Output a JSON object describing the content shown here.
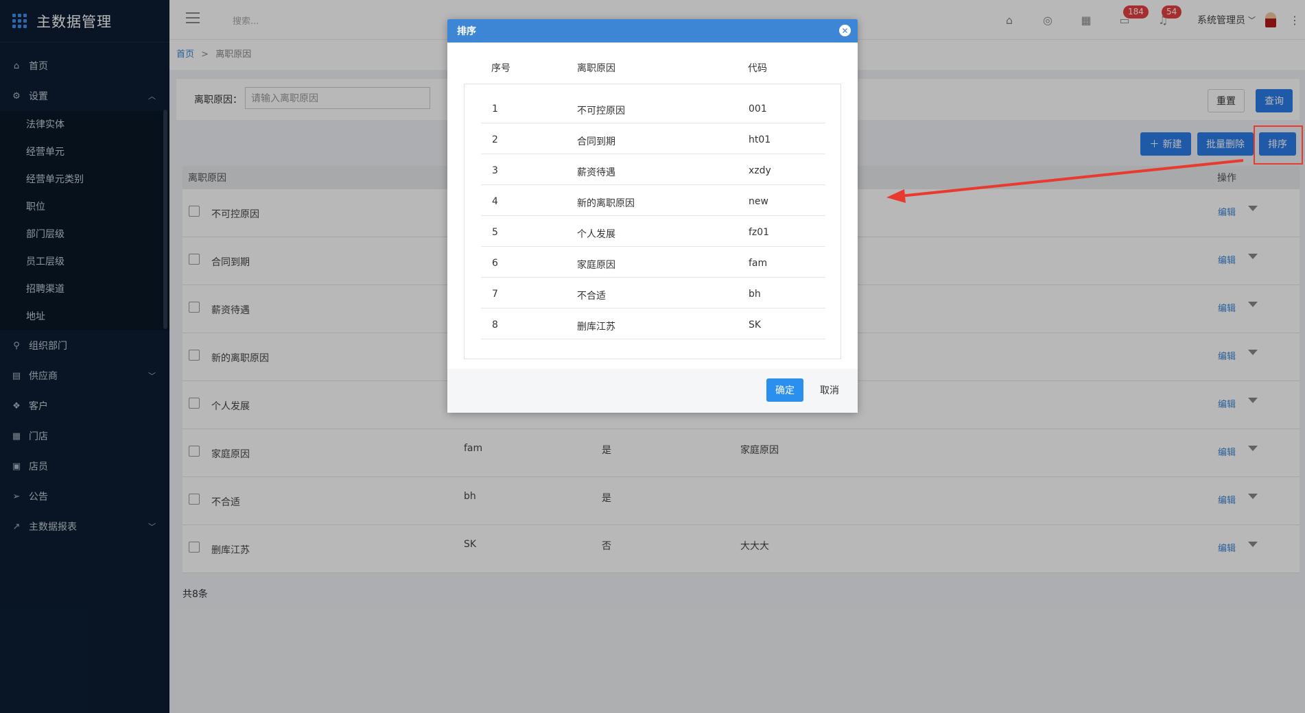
{
  "app": {
    "title": "主数据管理"
  },
  "sidebar": {
    "items": [
      {
        "label": "首页",
        "icon": "home-icon"
      },
      {
        "label": "设置",
        "icon": "gear-icon",
        "expanded": true
      },
      {
        "label": "组织部门",
        "icon": "org-icon"
      },
      {
        "label": "供应商",
        "icon": "supplier-icon",
        "expanded": false
      },
      {
        "label": "客户",
        "icon": "customer-icon"
      },
      {
        "label": "门店",
        "icon": "store-icon"
      },
      {
        "label": "店员",
        "icon": "staff-icon"
      },
      {
        "label": "公告",
        "icon": "notice-icon"
      },
      {
        "label": "主数据报表",
        "icon": "chart-icon",
        "expanded": false
      }
    ],
    "settings_sub": [
      "法律实体",
      "经营单元",
      "经营单元类别",
      "职位",
      "部门层级",
      "员工层级",
      "招聘渠道",
      "地址"
    ]
  },
  "topbar": {
    "search_placeholder": "搜索...",
    "badge_messages": "184",
    "badge_notifications": "54",
    "user": "系统管理员"
  },
  "breadcrumb": {
    "home": "首页",
    "separator": ">",
    "current": "离职原因"
  },
  "filter": {
    "label": "离职原因：",
    "placeholder": "请输入离职原因"
  },
  "buttons": {
    "reset": "重置",
    "query": "查询",
    "new": "新建",
    "batch_delete": "批量删除",
    "sort": "排序"
  },
  "table": {
    "header_name": "离职原因",
    "header_ops": "操作",
    "rows": [
      {
        "name": "不可控原因",
        "code": "",
        "enabled": "",
        "desc": ""
      },
      {
        "name": "合同到期",
        "code": "",
        "enabled": "",
        "desc": ""
      },
      {
        "name": "薪资待遇",
        "code": "",
        "enabled": "",
        "desc": ""
      },
      {
        "name": "新的离职原因",
        "code": "",
        "enabled": "",
        "desc": ""
      },
      {
        "name": "个人发展",
        "code": "",
        "enabled": "",
        "desc": ""
      },
      {
        "name": "家庭原因",
        "code": "fam",
        "enabled": "是",
        "desc": "家庭原因"
      },
      {
        "name": "不合适",
        "code": "bh",
        "enabled": "是",
        "desc": ""
      },
      {
        "name": "删库江苏",
        "code": "SK",
        "enabled": "否",
        "desc": "大大大"
      }
    ],
    "edit_label": "编辑",
    "total": "共8条"
  },
  "modal": {
    "title": "排序",
    "columns": {
      "seq": "序号",
      "reason": "离职原因",
      "code": "代码"
    },
    "rows": [
      {
        "seq": "1",
        "reason": "不可控原因",
        "code": "001"
      },
      {
        "seq": "2",
        "reason": "合同到期",
        "code": "ht01"
      },
      {
        "seq": "3",
        "reason": "薪资待遇",
        "code": "xzdy"
      },
      {
        "seq": "4",
        "reason": "新的离职原因",
        "code": "new"
      },
      {
        "seq": "5",
        "reason": "个人发展",
        "code": "fz01"
      },
      {
        "seq": "6",
        "reason": "家庭原因",
        "code": "fam"
      },
      {
        "seq": "7",
        "reason": "不合适",
        "code": "bh"
      },
      {
        "seq": "8",
        "reason": "删库江苏",
        "code": "SK"
      }
    ],
    "ok": "确定",
    "cancel": "取消"
  },
  "colors": {
    "sidebar_bg": "#0d1e33",
    "primary": "#2b7de9",
    "modal_header": "#3d86d6",
    "annotation": "#e83a2e"
  }
}
